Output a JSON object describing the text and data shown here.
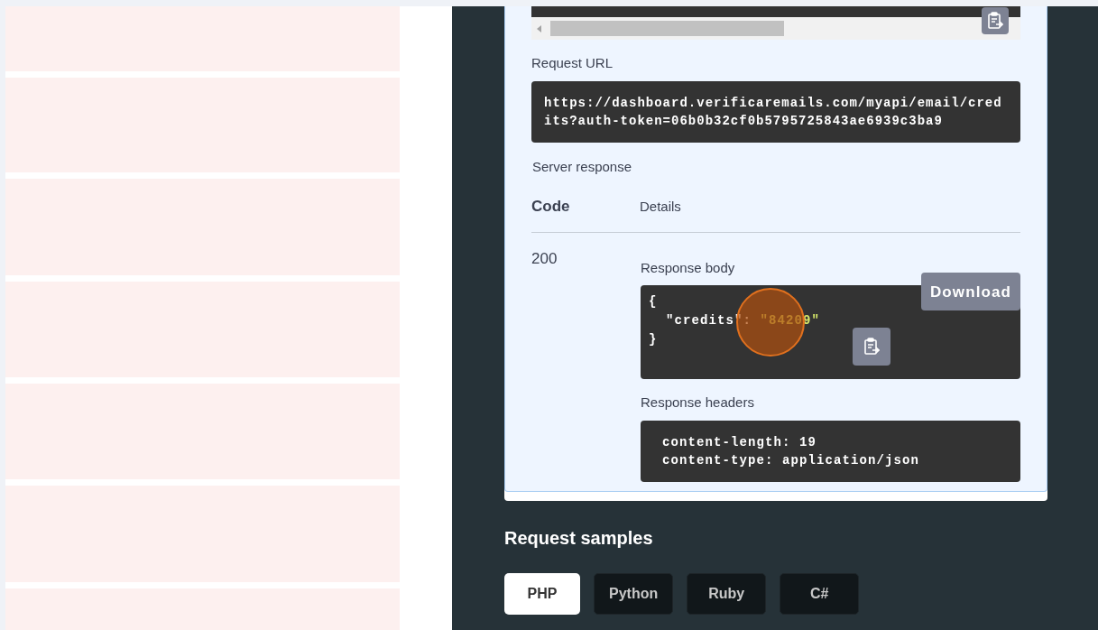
{
  "request_url": {
    "label": "Request URL",
    "value": "https://dashboard.verificaremails.com/myapi/email/credits?auth-token=06b0b32cf0b5795725843ae6939c3ba9"
  },
  "server_response": {
    "label": "Server response",
    "columns": [
      "Code",
      "Details"
    ],
    "code": "200",
    "response_body": {
      "label": "Response body",
      "download": "Download",
      "lines": [
        [
          {
            "text": "{",
            "kind": "punct"
          }
        ],
        [
          {
            "text": "  \"credits\"",
            "kind": "key"
          },
          {
            "text": ": ",
            "kind": "punct"
          },
          {
            "text": "\"84209\"",
            "kind": "string"
          }
        ],
        [
          {
            "text": "}",
            "kind": "punct"
          }
        ]
      ]
    },
    "response_headers": {
      "label": "Response headers",
      "lines": [
        "content-length: 19",
        "content-type: application/json"
      ]
    }
  },
  "request_samples": {
    "title": "Request samples",
    "tabs": [
      {
        "label": "PHP",
        "selected": true
      },
      {
        "label": "Python",
        "selected": false
      },
      {
        "label": "Ruby",
        "selected": false
      },
      {
        "label": "C#",
        "selected": false
      }
    ]
  }
}
